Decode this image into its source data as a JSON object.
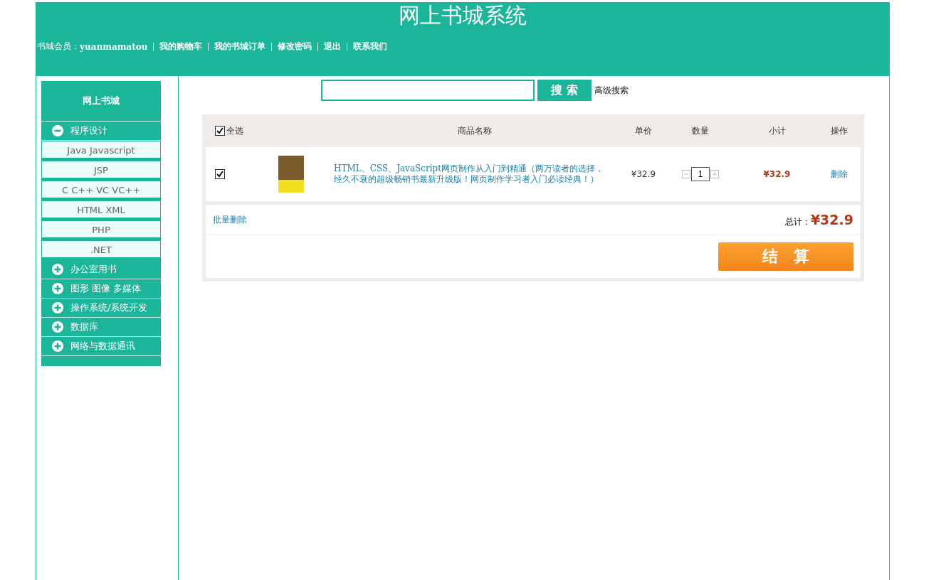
{
  "header": {
    "title": "网上书城系统",
    "member_label": "书城会员：",
    "username": "yuanmamatou",
    "nav": [
      "我的购物车",
      "我的书城订单",
      "修改密码",
      "退出",
      "联系我们"
    ]
  },
  "sidebar": {
    "title": "网上书城",
    "categories": [
      {
        "label": "程序设计",
        "expanded": true,
        "children": [
          "Java Javascript",
          "JSP",
          "C C++ VC VC++",
          "HTML XML",
          "PHP",
          ".NET"
        ]
      },
      {
        "label": "办公室用书",
        "expanded": false
      },
      {
        "label": "图形 图像 多媒体",
        "expanded": false
      },
      {
        "label": "操作系统/系统开发",
        "expanded": false
      },
      {
        "label": "数据库",
        "expanded": false
      },
      {
        "label": "网络与数据通讯",
        "expanded": false
      }
    ]
  },
  "search": {
    "button": "搜 索",
    "advanced": "高级搜索"
  },
  "cart": {
    "select_all": {
      "label": "全选",
      "checked": true
    },
    "columns": [
      "商品名称",
      "单价",
      "数量",
      "小计",
      "操作"
    ],
    "rows": [
      {
        "checked": true,
        "title": "HTML、CSS、JavaScript网页制作从入门到精通（两万读者的选择，经久不衰的超级畅销书最新升级版！网页制作学习者入门必读经典！）",
        "price": "¥32.9",
        "quantity": "1",
        "subtotal": "¥32.9",
        "action": "删除"
      }
    ],
    "batch_delete": "批量删除",
    "total_label": "总计：",
    "total": "¥32.9",
    "checkout": "结　算"
  }
}
